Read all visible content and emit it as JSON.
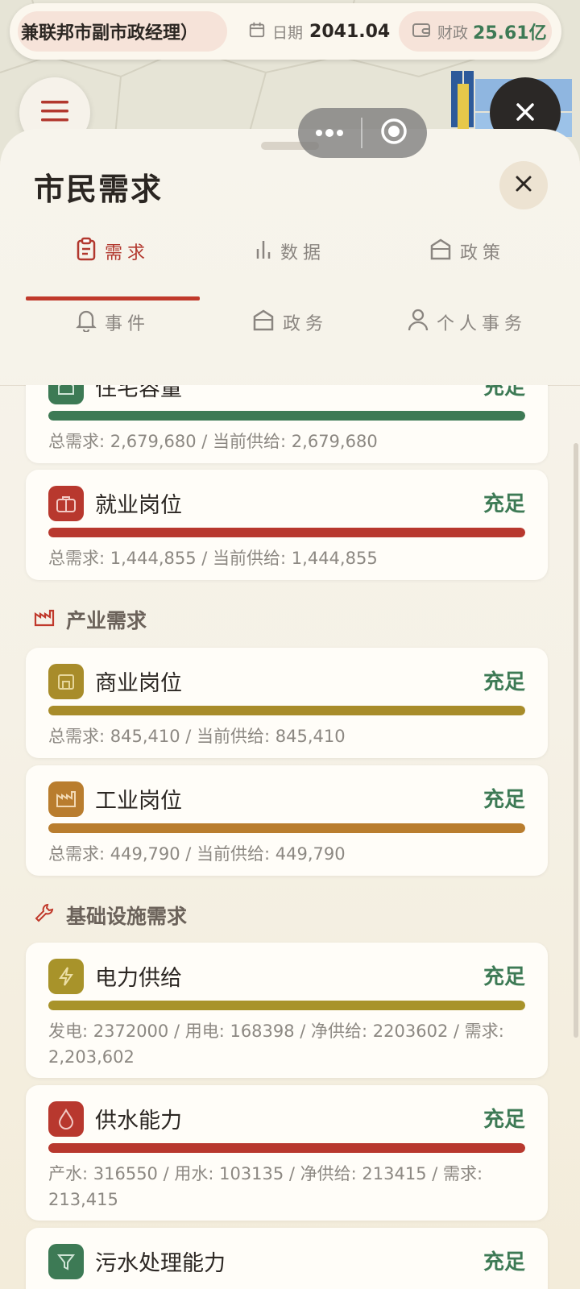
{
  "header": {
    "title": "兼联邦市副市政经理）",
    "date_label": "日期",
    "date_value": "2041.04",
    "finance_label": "财政",
    "finance_value": "25.61亿"
  },
  "sheet": {
    "title": "市民需求",
    "tabs": [
      {
        "label": "需求",
        "icon": "clipboard-icon",
        "active": true
      },
      {
        "label": "数据",
        "icon": "bar-chart-icon",
        "active": false
      },
      {
        "label": "政策",
        "icon": "building-icon",
        "active": false
      },
      {
        "label": "事件",
        "icon": "bell-icon",
        "active": false
      },
      {
        "label": "政务",
        "icon": "building-icon",
        "active": false
      },
      {
        "label": "个人事务",
        "icon": "person-icon",
        "active": false
      }
    ]
  },
  "colors": {
    "accent_red": "#c0392b",
    "status_green": "#3d7a55",
    "housing": "#3d7a55",
    "jobs": "#b8382e",
    "commerce": "#a88c2a",
    "industry": "#b97d2e",
    "power": "#a8932a",
    "water": "#b8382e"
  },
  "demands": {
    "housing": {
      "name": "住宅容量",
      "status": "充足",
      "detail": "总需求: 2,679,680 / 当前供给: 2,679,680",
      "fill": 1.0,
      "icon": "house-icon"
    },
    "jobs": {
      "name": "就业岗位",
      "status": "充足",
      "detail": "总需求: 1,444,855 / 当前供给: 1,444,855",
      "fill": 1.0,
      "icon": "briefcase-icon"
    },
    "industry_section": "产业需求",
    "commerce": {
      "name": "商业岗位",
      "status": "充足",
      "detail": "总需求: 845,410 / 当前供给: 845,410",
      "fill": 1.0,
      "icon": "shop-icon"
    },
    "industrial": {
      "name": "工业岗位",
      "status": "充足",
      "detail": "总需求: 449,790 / 当前供给: 449,790",
      "fill": 1.0,
      "icon": "factory-icon"
    },
    "infra_section": "基础设施需求",
    "power": {
      "name": "电力供给",
      "status": "充足",
      "detail": "发电: 2372000 / 用电: 168398 / 净供给: 2203602 / 需求: 2,203,602",
      "fill": 1.0,
      "icon": "lightning-icon"
    },
    "water": {
      "name": "供水能力",
      "status": "充足",
      "detail": "产水: 316550 / 用水: 103135 / 净供给: 213415 / 需求: 213,415",
      "fill": 1.0,
      "icon": "water-drop-icon"
    },
    "sewage": {
      "name": "污水处理能力",
      "status": "充足",
      "icon": "filter-icon"
    }
  }
}
